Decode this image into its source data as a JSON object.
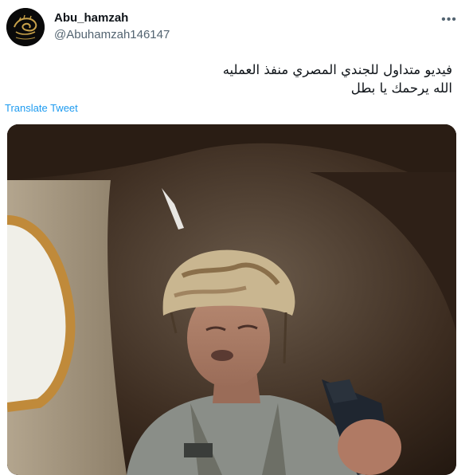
{
  "tweet": {
    "author_name": "Abu_hamzah",
    "author_handle": "@Abuhamzah146147",
    "text_lines": [
      "فيديو متداول للجندي المصري منفذ العمليه",
      "الله يرحمك يا بطل"
    ],
    "translate_label": "Translate Tweet"
  },
  "icons": {
    "avatar": "calligraphy-avatar",
    "more": "more-options-icon",
    "media": "video-thumbnail"
  },
  "colors": {
    "link": "#1d9bf0",
    "secondary_text": "#536471",
    "primary_text": "#0f1419"
  }
}
